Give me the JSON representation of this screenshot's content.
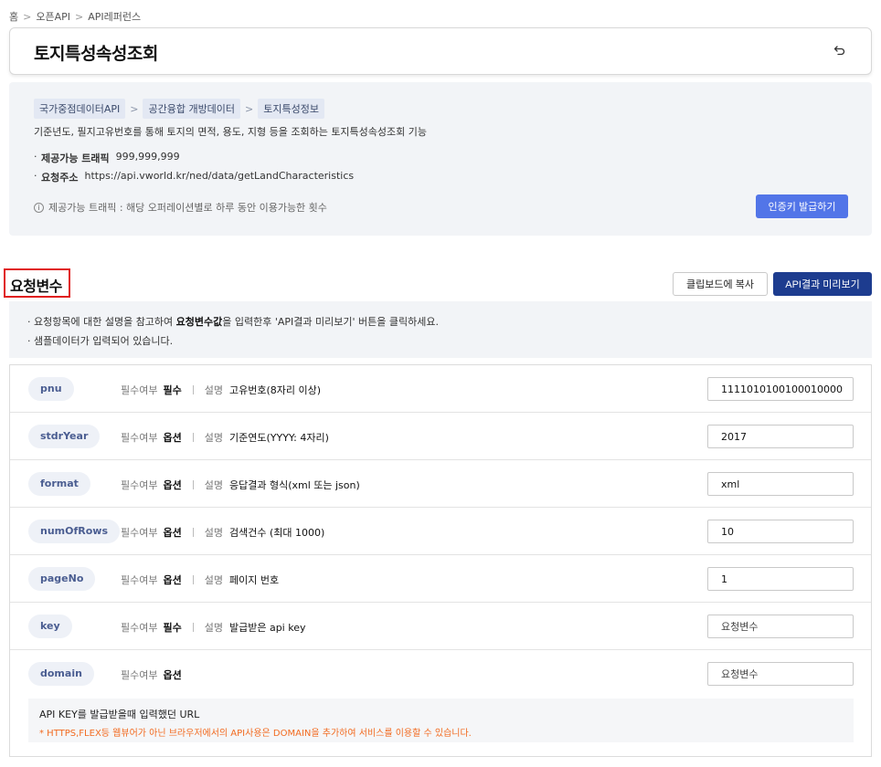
{
  "breadcrumb": {
    "items": [
      "홈",
      "오픈API",
      "API레퍼런스"
    ],
    "separator": ">"
  },
  "title": "토지특성속성조회",
  "info": {
    "tags": [
      "국가중점데이터API",
      "공간융합 개방데이터",
      "토지특성정보"
    ],
    "description": "기준년도, 필지고유번호를 통해 토지의 면적, 용도, 지형 등을 조회하는 토지특성속성조회 기능",
    "traffic_label": "제공가능 트래픽",
    "traffic_value": "999,999,999",
    "url_label": "요청주소",
    "url_value": "https://api.vworld.kr/ned/data/getLandCharacteristics",
    "notice": "제공가능 트래픽 : 해당 오퍼레이션별로 하루 동안 이용가능한 횟수",
    "auth_button": "인증키 발급하기"
  },
  "section": {
    "title": "요청변수",
    "copy_button": "클립보드에 복사",
    "preview_button": "API결과 미리보기",
    "guide_1_pre": "요청항목에 대한 설명을 참고하여 ",
    "guide_1_bold": "요청변수값",
    "guide_1_post": "을 입력한후 'API결과 미리보기' 버튼을 클릭하세요.",
    "guide_2": "샘플데이터가 입력되어 있습니다."
  },
  "param_labels": {
    "required": "필수여부",
    "desc": "설명"
  },
  "params": [
    {
      "name": "pnu",
      "required": "필수",
      "desc": "고유번호(8자리 이상)",
      "value": "1111010100100010000",
      "placeholder": ""
    },
    {
      "name": "stdrYear",
      "required": "옵션",
      "desc": "기준연도(YYYY: 4자리)",
      "value": "2017",
      "placeholder": ""
    },
    {
      "name": "format",
      "required": "옵션",
      "desc": "응답결과 형식(xml 또는 json)",
      "value": "xml",
      "placeholder": ""
    },
    {
      "name": "numOfRows",
      "required": "옵션",
      "desc": "검색건수 (최대 1000)",
      "value": "10",
      "placeholder": ""
    },
    {
      "name": "pageNo",
      "required": "옵션",
      "desc": "페이지 번호",
      "value": "1",
      "placeholder": ""
    },
    {
      "name": "key",
      "required": "필수",
      "desc": "발급받은 api key",
      "value": "",
      "placeholder": "요청변수"
    },
    {
      "name": "domain",
      "required": "옵션",
      "desc": "",
      "value": "",
      "placeholder": "요청변수"
    }
  ],
  "domain_note": {
    "line1": "API KEY를 발급받을때 입력했던 URL",
    "line2": "* HTTPS,FLEX등 웹뷰어가 아닌 브라우저에서의 API사용은 DOMAIN을 추가하여 서비스를 이용할 수 있습니다."
  },
  "colors": {
    "accent_blue": "#5275e8",
    "dark_navy": "#1d3c8f",
    "highlight_red": "#e01d1d",
    "note_orange": "#f26b21"
  },
  "icons": {
    "back": "return-arrow-icon",
    "notice": "info-circle-icon"
  }
}
